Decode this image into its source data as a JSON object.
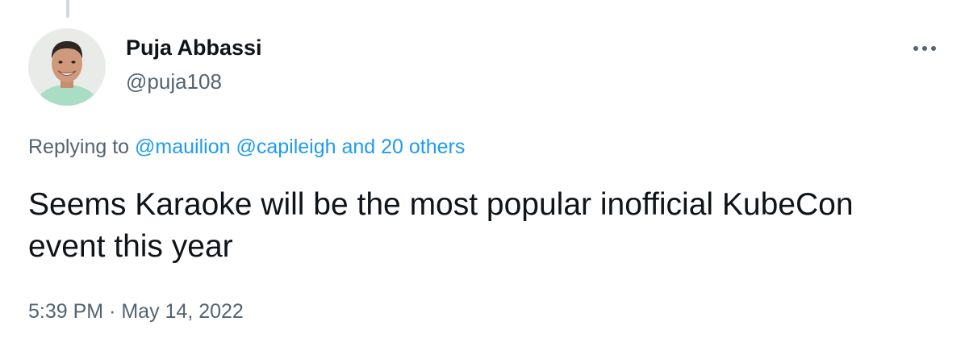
{
  "tweet": {
    "author": {
      "display_name": "Puja Abbassi",
      "handle": "@puja108"
    },
    "reply_context": {
      "prefix": "Replying to",
      "mentions": [
        "@mauilion",
        "@capileigh"
      ],
      "others": "and 20 others"
    },
    "text": "Seems Karaoke will be the most popular inofficial KubeCon event this year",
    "time": "5:39 PM",
    "separator": "·",
    "date": "May 14, 2022"
  },
  "icons": {
    "more": "more-horizontal-icon",
    "avatar": "profile-photo"
  },
  "colors": {
    "text_primary": "#0f1419",
    "text_secondary": "#536471",
    "link": "#1d9bf0",
    "thread_line": "#cfd9de"
  }
}
